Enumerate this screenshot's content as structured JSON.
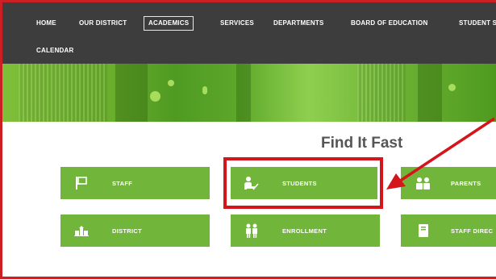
{
  "nav": {
    "items": [
      {
        "label": "HOME",
        "active": false
      },
      {
        "label": "OUR DISTRICT",
        "active": false
      },
      {
        "label": "ACADEMICS",
        "active": true
      },
      {
        "label": "SERVICES",
        "active": false
      },
      {
        "label": "DEPARTMENTS",
        "active": false
      },
      {
        "label": "BOARD OF EDUCATION",
        "active": false
      },
      {
        "label": "STUDENT S",
        "active": false
      }
    ],
    "row2": [
      {
        "label": "CALENDAR",
        "active": false
      }
    ]
  },
  "main": {
    "title": "Find It Fast",
    "tiles": [
      {
        "label": "STAFF",
        "icon": "sign-icon"
      },
      {
        "label": "STUDENTS",
        "icon": "student-icon"
      },
      {
        "label": "PARENTS",
        "icon": "people-icon"
      },
      {
        "label": "DISTRICT",
        "icon": "building-icon"
      },
      {
        "label": "ENROLLMENT",
        "icon": "two-people-icon"
      },
      {
        "label": "STAFF DIREC",
        "icon": "book-icon"
      }
    ]
  },
  "colors": {
    "nav_bg": "#3d3d3d",
    "tile_green": "#71b53a",
    "highlight_red": "#d4161c"
  }
}
